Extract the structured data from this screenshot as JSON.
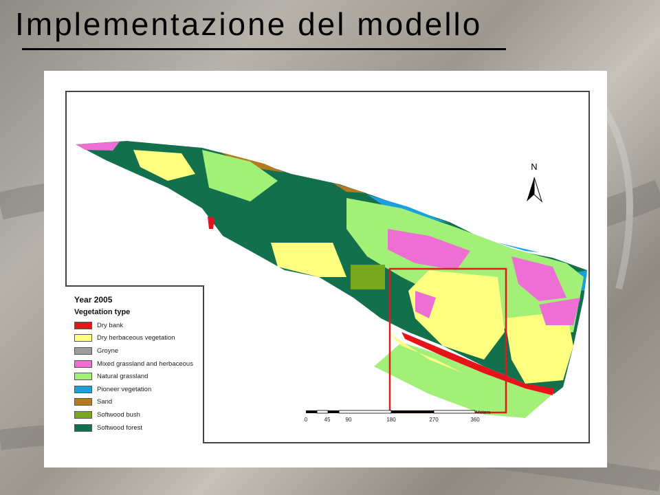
{
  "slide": {
    "title": "Implementazione del modello"
  },
  "map": {
    "north_label": "N",
    "legend": {
      "year": "Year 2005",
      "heading": "Vegetation type",
      "items": [
        {
          "label": "Dry bank",
          "color": "#e8131a"
        },
        {
          "label": "Dry herbaceous vegetation",
          "color": "#ffff80"
        },
        {
          "label": "Groyne",
          "color": "#9c9c9c"
        },
        {
          "label": "Mixed grassland and herbaceous",
          "color": "#ee6fd3"
        },
        {
          "label": "Natural grassland",
          "color": "#a3f078"
        },
        {
          "label": "Pioneer vegetation",
          "color": "#1aa0dd"
        },
        {
          "label": "Sand",
          "color": "#b57a1d"
        },
        {
          "label": "Softwood bush",
          "color": "#79a81c"
        },
        {
          "label": "Softwood forest",
          "color": "#13704d"
        }
      ]
    },
    "scale_bar": {
      "unit": "Meters",
      "ticks": [
        "0",
        "45",
        "90",
        "180",
        "270",
        "360"
      ]
    },
    "highlight_color": "#e31a1c"
  }
}
